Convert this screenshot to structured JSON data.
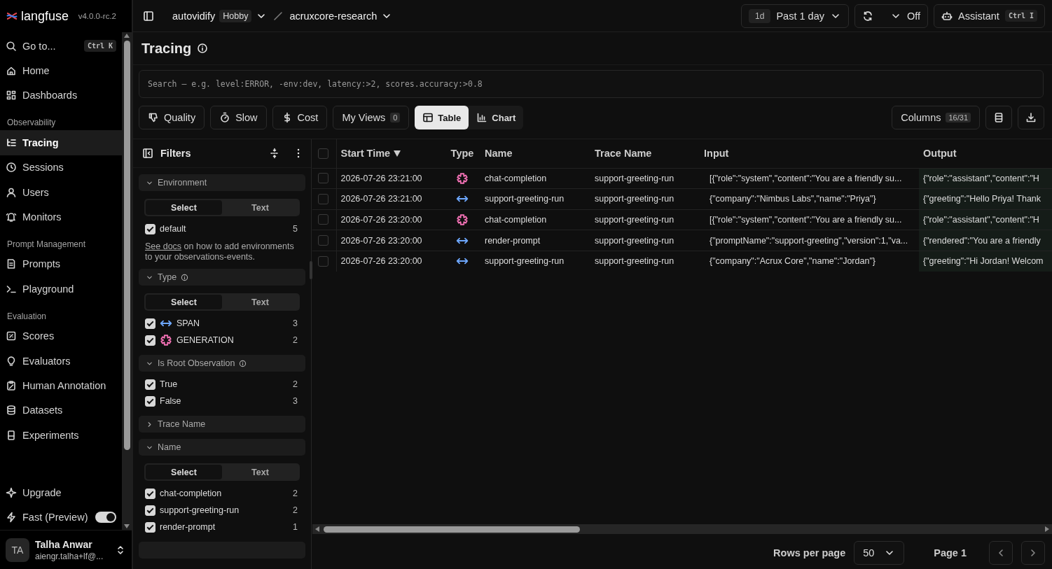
{
  "brand": {
    "name": "langfuse",
    "version": "v4.0.0-rc.2"
  },
  "sidebar": {
    "goto": {
      "label": "Go to...",
      "shortcut": "Ctrl K"
    },
    "groups": [
      {
        "items": [
          {
            "label": "Home",
            "selected": false
          },
          {
            "label": "Dashboards",
            "selected": false
          }
        ]
      },
      {
        "title": "Observability",
        "items": [
          {
            "label": "Tracing",
            "selected": true
          },
          {
            "label": "Sessions",
            "selected": false
          },
          {
            "label": "Users",
            "selected": false
          },
          {
            "label": "Monitors",
            "selected": false
          }
        ]
      },
      {
        "title": "Prompt Management",
        "items": [
          {
            "label": "Prompts",
            "selected": false
          },
          {
            "label": "Playground",
            "selected": false
          }
        ]
      },
      {
        "title": "Evaluation",
        "items": [
          {
            "label": "Scores",
            "selected": false
          },
          {
            "label": "Evaluators",
            "selected": false
          },
          {
            "label": "Human Annotation",
            "selected": false
          },
          {
            "label": "Datasets",
            "selected": false
          },
          {
            "label": "Experiments",
            "selected": false
          }
        ]
      }
    ],
    "footer_items": [
      {
        "kind": "link",
        "label": "Upgrade"
      },
      {
        "kind": "toggle",
        "label": "Fast (Preview)",
        "on": true
      }
    ],
    "user": {
      "initials": "TA",
      "name": "Talha Anwar",
      "email": "aiengr.talha+lf@..."
    }
  },
  "topbar": {
    "organization": "autovidify",
    "plan": "Hobby",
    "project": "acruxcore-research",
    "time_range": {
      "badge": "1d",
      "label": "Past 1 day"
    },
    "refresh": {
      "label": "Off"
    },
    "assistant": {
      "label": "Assistant",
      "shortcut": "Ctrl I"
    }
  },
  "page": {
    "title": "Tracing"
  },
  "search": {
    "placeholder": "Search — e.g. level:ERROR, -env:dev, latency:>2, scores.accuracy:>0.8"
  },
  "quick_filters": [
    {
      "label": "Quality"
    },
    {
      "label": "Slow"
    },
    {
      "label": "Cost"
    },
    {
      "label": "My Views",
      "count": "0"
    }
  ],
  "view_modes": [
    {
      "label": "Table",
      "selected": true
    },
    {
      "label": "Chart",
      "selected": false
    }
  ],
  "columns_button": {
    "label": "Columns",
    "count": "16/31"
  },
  "filters": {
    "title": "Filters",
    "sections": [
      {
        "title": "Environment",
        "expanded": true,
        "info": false,
        "modes": [
          {
            "label": "Select",
            "selected": true
          },
          {
            "label": "Text",
            "selected": false
          }
        ],
        "options": [
          {
            "label": "default",
            "count": "5",
            "checked": true
          }
        ],
        "note": {
          "link": "See docs",
          "text": " on how to add environments to your observations-events."
        }
      },
      {
        "title": "Type",
        "expanded": true,
        "info": true,
        "modes": [
          {
            "label": "Select",
            "selected": true
          },
          {
            "label": "Text",
            "selected": false
          }
        ],
        "options": [
          {
            "label": "SPAN",
            "count": "3",
            "checked": true,
            "kind": "span"
          },
          {
            "label": "GENERATION",
            "count": "2",
            "checked": true,
            "kind": "generation"
          }
        ]
      },
      {
        "title": "Is Root Observation",
        "expanded": true,
        "info": true,
        "options": [
          {
            "label": "True",
            "count": "2",
            "checked": true
          },
          {
            "label": "False",
            "count": "3",
            "checked": true
          }
        ]
      },
      {
        "title": "Trace Name",
        "expanded": false,
        "info": false
      },
      {
        "title": "Name",
        "expanded": true,
        "info": false,
        "modes": [
          {
            "label": "Select",
            "selected": true
          },
          {
            "label": "Text",
            "selected": false
          }
        ],
        "options": [
          {
            "label": "chat-completion",
            "count": "2",
            "checked": true
          },
          {
            "label": "support-greeting-run",
            "count": "2",
            "checked": true
          },
          {
            "label": "render-prompt",
            "count": "1",
            "checked": true
          }
        ]
      }
    ]
  },
  "table": {
    "columns": [
      {
        "label": "Start Time",
        "sorted": true
      },
      {
        "label": "Type",
        "sorted": false
      },
      {
        "label": "Name",
        "sorted": false
      },
      {
        "label": "Trace Name",
        "sorted": false
      },
      {
        "label": "Input",
        "sorted": false
      },
      {
        "label": "Output",
        "sorted": false
      }
    ],
    "all_checked": false,
    "rows": [
      {
        "checked": false,
        "start_time": "2026-07-26 23:21:00",
        "kind": "generation",
        "name": "chat-completion",
        "trace_name": "support-greeting-run",
        "input": "[{\"role\":\"system\",\"content\":\"You are a friendly su...",
        "output": "{\"role\":\"assistant\",\"content\":\"H"
      },
      {
        "checked": false,
        "start_time": "2026-07-26 23:21:00",
        "kind": "span",
        "name": "support-greeting-run",
        "trace_name": "support-greeting-run",
        "input": "{\"company\":\"Nimbus Labs\",\"name\":\"Priya\"}",
        "output": "{\"greeting\":\"Hello Priya! Thank"
      },
      {
        "checked": false,
        "start_time": "2026-07-26 23:20:00",
        "kind": "generation",
        "name": "chat-completion",
        "trace_name": "support-greeting-run",
        "input": "[{\"role\":\"system\",\"content\":\"You are a friendly su...",
        "output": "{\"role\":\"assistant\",\"content\":\"H"
      },
      {
        "checked": false,
        "start_time": "2026-07-26 23:20:00",
        "kind": "span",
        "name": "render-prompt",
        "trace_name": "support-greeting-run",
        "input": "{\"promptName\":\"support-greeting\",\"version\":1,\"va...",
        "output": "{\"rendered\":\"You are a friendly"
      },
      {
        "checked": false,
        "start_time": "2026-07-26 23:20:00",
        "kind": "span",
        "name": "support-greeting-run",
        "trace_name": "support-greeting-run",
        "input": "{\"company\":\"Acrux Core\",\"name\":\"Jordan\"}",
        "output": "{\"greeting\":\"Hi Jordan! Welcom"
      }
    ]
  },
  "footer": {
    "rows_per_page_label": "Rows per page",
    "rows_per_page": "50",
    "page": "Page 1"
  }
}
